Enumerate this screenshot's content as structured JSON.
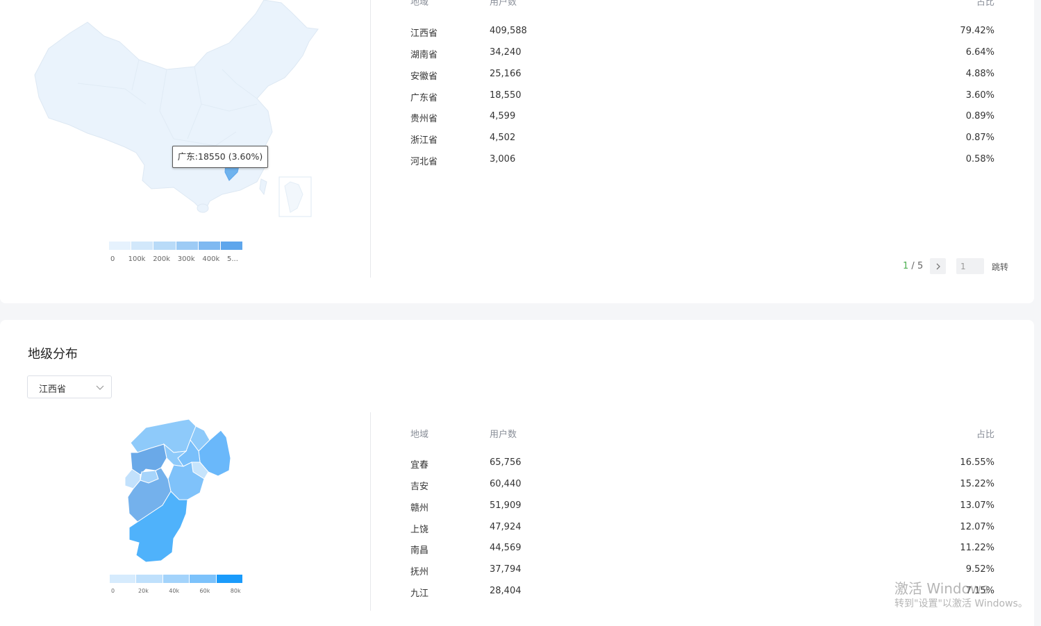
{
  "province_section": {
    "columns": {
      "region": "地域",
      "users": "用户数",
      "share": "占比"
    },
    "rows": [
      {
        "region": "江西省",
        "users": "409,588",
        "share": "79.42%"
      },
      {
        "region": "湖南省",
        "users": "34,240",
        "share": "6.64%"
      },
      {
        "region": "安徽省",
        "users": "25,166",
        "share": "4.88%"
      },
      {
        "region": "广东省",
        "users": "18,550",
        "share": "3.60%"
      },
      {
        "region": "贵州省",
        "users": "4,599",
        "share": "0.89%"
      },
      {
        "region": "浙江省",
        "users": "4,502",
        "share": "0.87%"
      },
      {
        "region": "河北省",
        "users": "3,006",
        "share": "0.58%"
      }
    ],
    "map_tooltip": "广东:18550 (3.60%)",
    "legend_ticks": [
      "0",
      "100k",
      "200k",
      "300k",
      "400k",
      "5..."
    ],
    "legend_colors": [
      "#e6f2fd",
      "#d2e8fb",
      "#b9dbf8",
      "#9dcbf5",
      "#7fb9f1",
      "#5ea6ec"
    ],
    "pagination": {
      "current": "1",
      "total": "5",
      "next_icon": "chevron-right-icon",
      "input_value": "1",
      "jump_label": "跳转"
    }
  },
  "city_section": {
    "title": "地级分布",
    "province_select": {
      "value": "江西省",
      "icon": "chevron-down-icon"
    },
    "columns": {
      "region": "地域",
      "users": "用户数",
      "share": "占比"
    },
    "rows": [
      {
        "region": "宜春",
        "users": "65,756",
        "share": "16.55%"
      },
      {
        "region": "吉安",
        "users": "60,440",
        "share": "15.22%"
      },
      {
        "region": "赣州",
        "users": "51,909",
        "share": "13.07%"
      },
      {
        "region": "上饶",
        "users": "47,924",
        "share": "12.07%"
      },
      {
        "region": "南昌",
        "users": "44,569",
        "share": "11.22%"
      },
      {
        "region": "抚州",
        "users": "37,794",
        "share": "9.52%"
      },
      {
        "region": "九江",
        "users": "28,404",
        "share": "7.15%"
      }
    ],
    "legend_ticks": [
      "0",
      "20k",
      "40k",
      "60k",
      "80k"
    ],
    "legend_colors": [
      "#d6ebfd",
      "#bfe0fc",
      "#a3d3fb",
      "#7cc2fb",
      "#1a9bfb"
    ]
  },
  "os_watermark": {
    "line1": "激活 Windows",
    "line2": "转到\"设置\"以激活 Windows。"
  },
  "colors": {
    "accent": "#1a9bfb",
    "pager_current": "#4caf50",
    "map_base": "#eaf3fc"
  }
}
